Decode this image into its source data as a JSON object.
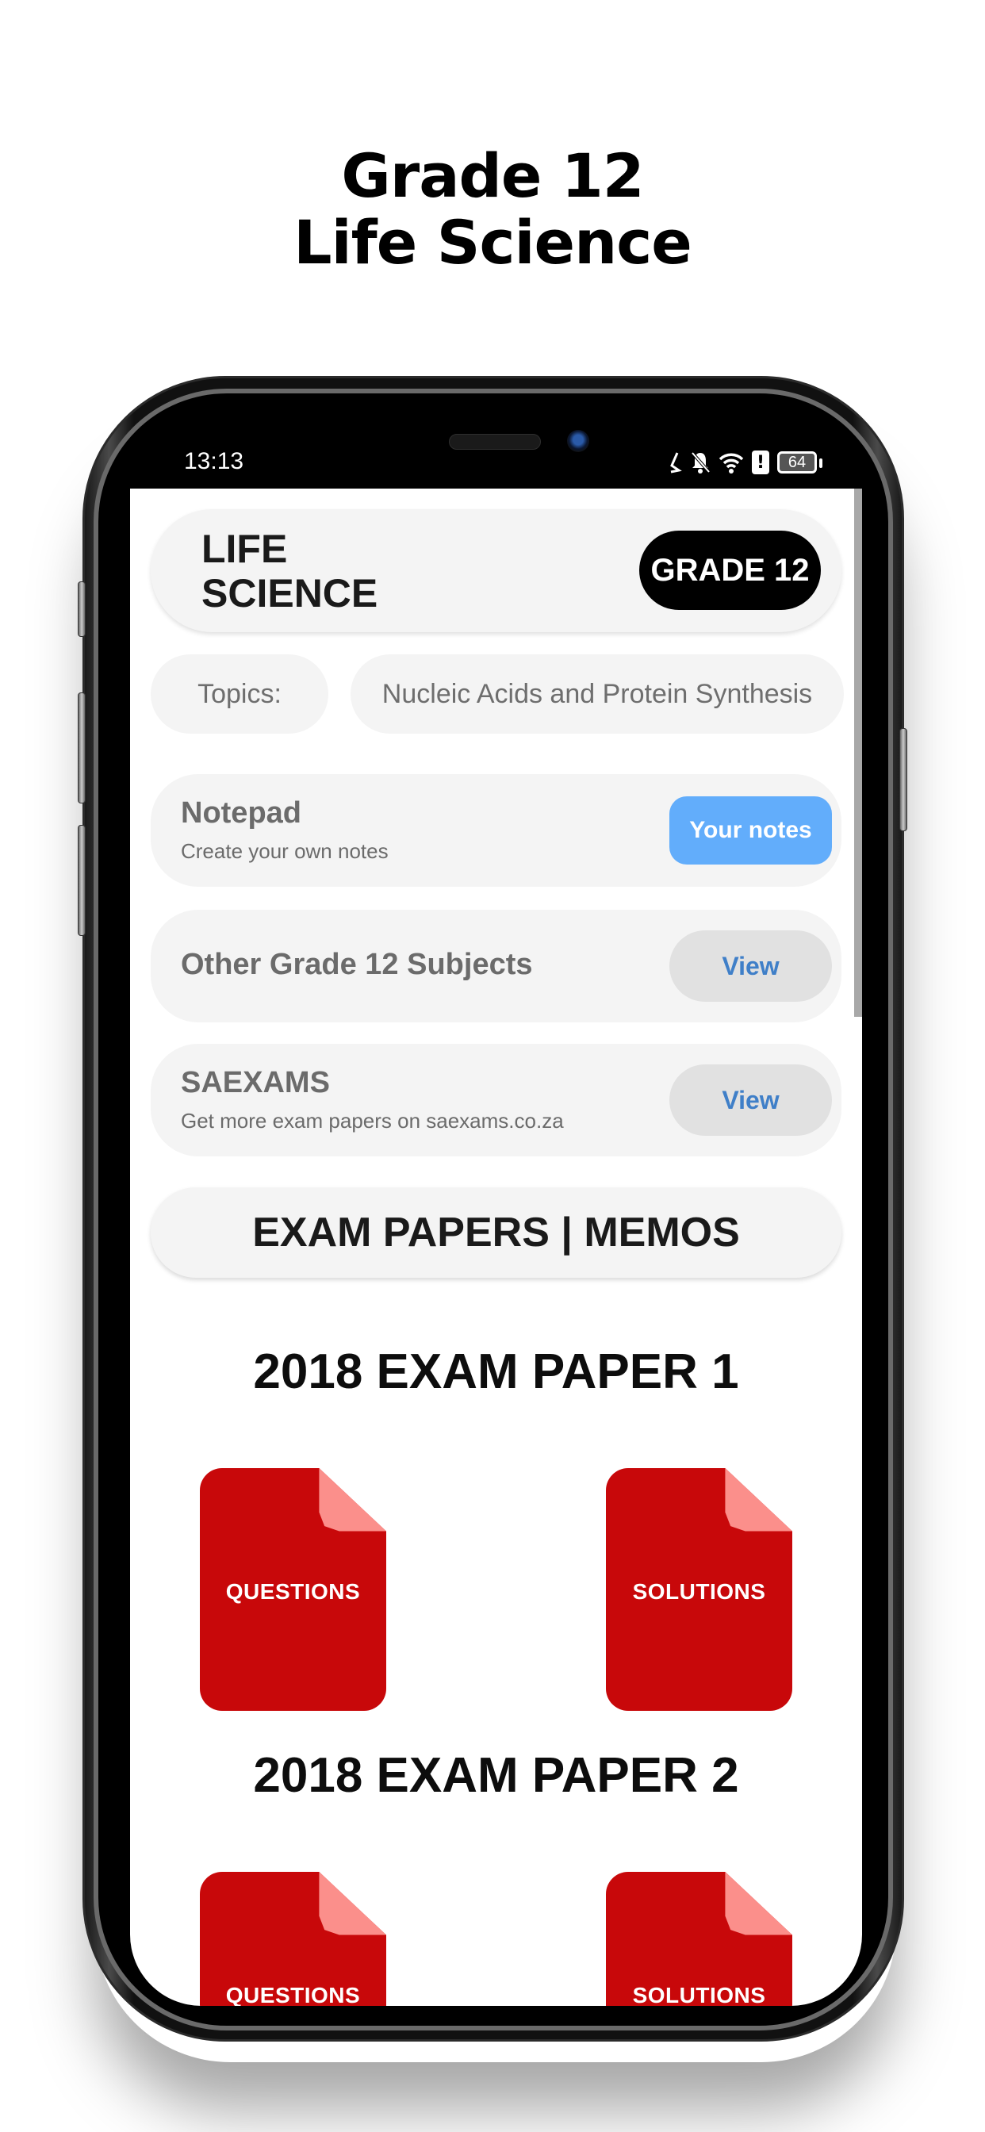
{
  "promo": {
    "line1": "Grade 12",
    "line2": "Life Science"
  },
  "status_bar": {
    "time": "13:13",
    "icons": [
      "nfc-icon",
      "bell-muted-icon",
      "wifi-icon",
      "alert-icon",
      "battery-icon"
    ],
    "battery_level": "64"
  },
  "header": {
    "subject_line1": "LIFE",
    "subject_line2": "SCIENCE",
    "grade_badge": "GRADE 12"
  },
  "topics": {
    "label": "Topics:",
    "selected": "Nucleic Acids and Protein Synthesis"
  },
  "cards": {
    "notepad": {
      "title": "Notepad",
      "subtitle": "Create your own notes",
      "button": "Your notes"
    },
    "other_subjects": {
      "title": "Other Grade 12 Subjects",
      "button": "View"
    },
    "saexams": {
      "title": "SAEXAMS",
      "subtitle": "Get more exam papers on saexams.co.za",
      "button": "View"
    }
  },
  "exam_section": {
    "title": "EXAM PAPERS | MEMOS",
    "papers": [
      {
        "heading": "2018 EXAM PAPER 1",
        "questions_label": "QUESTIONS",
        "solutions_label": "SOLUTIONS"
      },
      {
        "heading": "2018 EXAM PAPER 2",
        "questions_label": "QUESTIONS",
        "solutions_label": "SOLUTIONS"
      }
    ]
  },
  "colors": {
    "pdf_red": "#c8080a",
    "pdf_fold": "#fb8f8b",
    "notes_button": "#62adfb",
    "view_text": "#3f7fc8",
    "card_bg": "#f4f4f4"
  }
}
